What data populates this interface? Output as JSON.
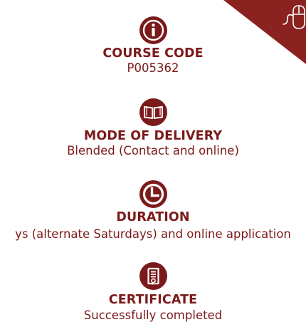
{
  "colors": {
    "accent": "#7b1a1a",
    "corner": "#8a2320"
  },
  "corner_icon": "mouse-scroll-icon",
  "course_code": {
    "icon": "info-icon",
    "title": "COURSE CODE",
    "value": "P005362"
  },
  "mode_of_delivery": {
    "icon": "book-icon",
    "title": "MODE OF DELIVERY",
    "value": "Blended (Contact and online)"
  },
  "duration": {
    "icon": "clock-icon",
    "title": "DURATION",
    "value": "ys (alternate Saturdays) and online application"
  },
  "certificate": {
    "icon": "certificate-icon",
    "title": "CERTIFICATE",
    "value": "Successfully completed"
  }
}
